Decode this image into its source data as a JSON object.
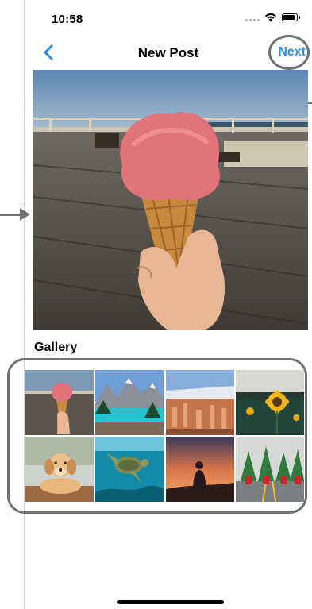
{
  "status_bar": {
    "time": "10:58",
    "battery_level": 0.85
  },
  "nav": {
    "title": "New Post",
    "next_label": "Next"
  },
  "gallery": {
    "heading": "Gallery",
    "items": [
      {
        "subject": "ice-cream-cone"
      },
      {
        "subject": "mountain-lake"
      },
      {
        "subject": "canyon-hoodoos"
      },
      {
        "subject": "sunflower"
      },
      {
        "subject": "puppy"
      },
      {
        "subject": "sea-turtle"
      },
      {
        "subject": "sunset-silhouette"
      },
      {
        "subject": "costume-parade"
      }
    ]
  },
  "colors": {
    "accent": "#2e8bf0",
    "annotation": "#707070"
  }
}
